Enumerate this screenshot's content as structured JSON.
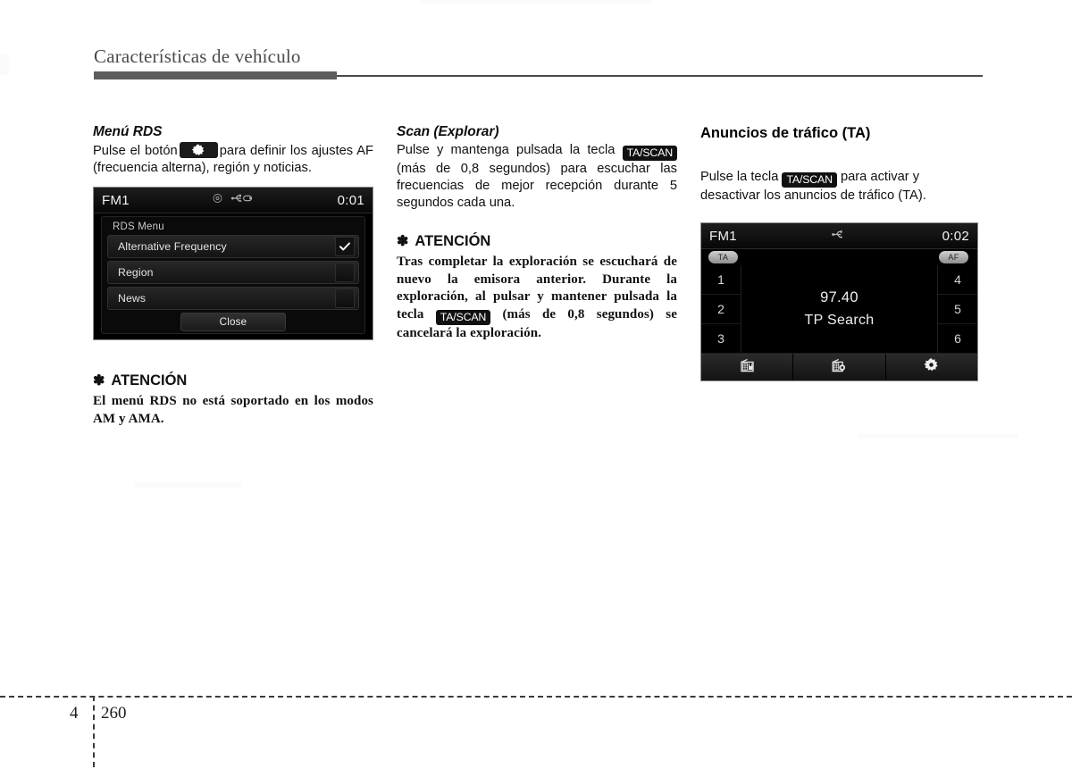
{
  "header": {
    "title": "Características de vehículo"
  },
  "footer": {
    "chapter": "4",
    "page": "260"
  },
  "columns": {
    "col1": {
      "sub_head": "Menú RDS",
      "text_before_button": "Pulse el botón",
      "button_icon": "gear-icon",
      "text_after_button": "para definir los ajustes AF (frecuencia alterna), región y noticias.",
      "device": {
        "source": "FM1",
        "clock": "0:01",
        "icons": [
          "disc-icon",
          "usb-icon"
        ],
        "panel_title": "RDS Menu",
        "rows": [
          {
            "label": "Alternative Frequency",
            "checked": true
          },
          {
            "label": "Region",
            "checked": false
          },
          {
            "label": "News",
            "checked": false
          }
        ],
        "close_label": "Close"
      },
      "attention": {
        "star": "✽",
        "title": "ATENCIÓN",
        "body": "El menú RDS no está soportado en los modos AM y AMA."
      }
    },
    "col2": {
      "sub_head": "Scan (Explorar)",
      "text_part1": "Pulse y mantenga pulsada la tecla",
      "key_label": "TA/SCAN",
      "text_part2": "(más de 0,8 segundos) para escuchar las frecuencias de mejor recepción durante 5 segundos cada una.",
      "attention": {
        "star": "✽",
        "title": "ATENCIÓN",
        "body_part1": "Tras completar la exploración se escuchará de nuevo la emisora anterior. Durante la exploración, al pulsar y mantener pulsada la tecla",
        "key_label": "TA/SCAN",
        "body_part2": "(más de 0,8 segundos) se cancelará la exploración."
      }
    },
    "col3": {
      "sec_head": "Anuncios de tráfico (TA)",
      "text_part1": "Pulse la tecla",
      "key_label": "TA/SCAN",
      "text_part2": "para activar y desactivar los anuncios de tráfico (TA).",
      "device": {
        "source": "FM1",
        "clock": "0:02",
        "icons": [
          "usb-icon"
        ],
        "badges": [
          "TA",
          "AF"
        ],
        "presets_left": [
          "1",
          "2",
          "3"
        ],
        "presets_right": [
          "4",
          "5",
          "6"
        ],
        "frequency": "97.40",
        "status": "TP Search",
        "toolbar_icons": [
          "radio-save-icon",
          "radio-search-icon",
          "gear-icon"
        ]
      }
    }
  },
  "colors": {
    "header_rule": "#5d5d5d",
    "device_bg": "#000000",
    "device_text": "#f2f2f2",
    "key_token_bg": "#111111"
  }
}
